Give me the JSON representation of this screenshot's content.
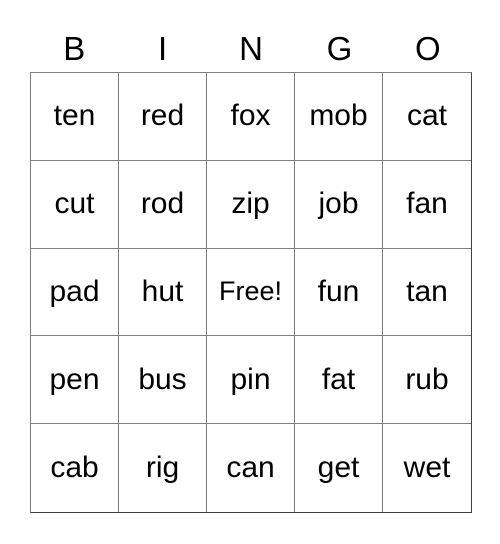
{
  "card": {
    "title": "BINGO",
    "header_letters": [
      "B",
      "I",
      "N",
      "G",
      "O"
    ],
    "free_space_label": "Free!",
    "free_space_position": {
      "row": 2,
      "col": 2
    },
    "colors": {
      "background": "#ffffff",
      "cell_background": "#ffffff",
      "grid_line": "#808080",
      "outer_border": "#404040",
      "text": "#000000"
    },
    "grid_size": {
      "rows": 5,
      "cols": 5
    },
    "rows": [
      [
        "ten",
        "red",
        "fox",
        "mob",
        "cat"
      ],
      [
        "cut",
        "rod",
        "zip",
        "job",
        "fan"
      ],
      [
        "pad",
        "hut",
        "Free!",
        "fun",
        "tan"
      ],
      [
        "pen",
        "bus",
        "pin",
        "fat",
        "rub"
      ],
      [
        "cab",
        "rig",
        "can",
        "get",
        "wet"
      ]
    ]
  }
}
